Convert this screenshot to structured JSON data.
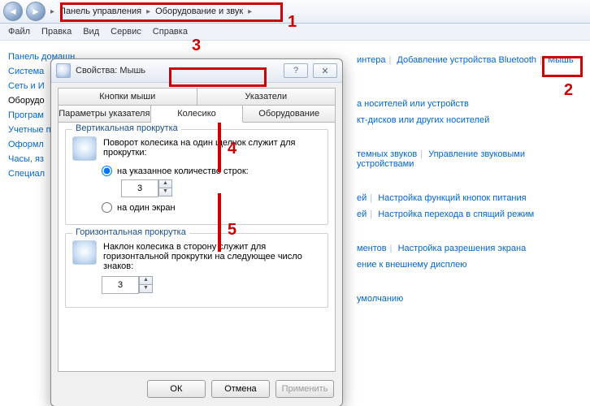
{
  "breadcrumb": {
    "item1": "Панель управления",
    "item2": "Оборудование и звук"
  },
  "menubar": {
    "file": "Файл",
    "edit": "Правка",
    "view": "Вид",
    "service": "Сервис",
    "help": "Справка"
  },
  "sidebar": {
    "items": [
      "Панель домашн",
      "Система",
      "Сеть и И",
      "Оборудо",
      "Програм",
      "Учетные пользов безопасн",
      "Оформл",
      "Часы, яз",
      "Специал"
    ]
  },
  "right": {
    "line1_a": "интера",
    "line1_b": "Добавление устройства Bluetooth",
    "line1_c": "Мышь",
    "line2_a": "а носителей или устройств",
    "line2_b": "кт-дисков или других носителей",
    "line3_a": "темных звуков",
    "line3_b": "Управление звуковыми устройствами",
    "line4_a": "ей",
    "line4_b": "Настройка функций кнопок питания",
    "line4_c": "ей",
    "line4_d": "Настройка перехода в спящий режим",
    "line5_a": "ментов",
    "line5_b": "Настройка разрешения экрана",
    "line5_c": "ение к внешнему дисплею",
    "line6_a": "умолчанию"
  },
  "dialog": {
    "title": "Свойства: Мышь",
    "tabs": {
      "buttons": "Кнопки мыши",
      "pointers": "Указатели",
      "pointer_opts": "Параметры указателя",
      "wheel": "Колесико",
      "hardware": "Оборудование"
    },
    "vscroll": {
      "legend": "Вертикальная прокрутка",
      "desc": "Поворот колесика на один щелчок служит для прокрутки:",
      "opt_lines": "на указанное количество строк:",
      "lines_value": "3",
      "opt_screen": "на один экран"
    },
    "hscroll": {
      "legend": "Горизонтальная прокрутка",
      "desc": "Наклон колесика в сторону служит для горизонтальной прокрутки на следующее число знаков:",
      "chars_value": "3"
    },
    "buttons": {
      "ok": "ОК",
      "cancel": "Отмена",
      "apply": "Применить"
    }
  },
  "annotations": {
    "n1": "1",
    "n2": "2",
    "n3": "3",
    "n4": "4",
    "n5": "5"
  }
}
